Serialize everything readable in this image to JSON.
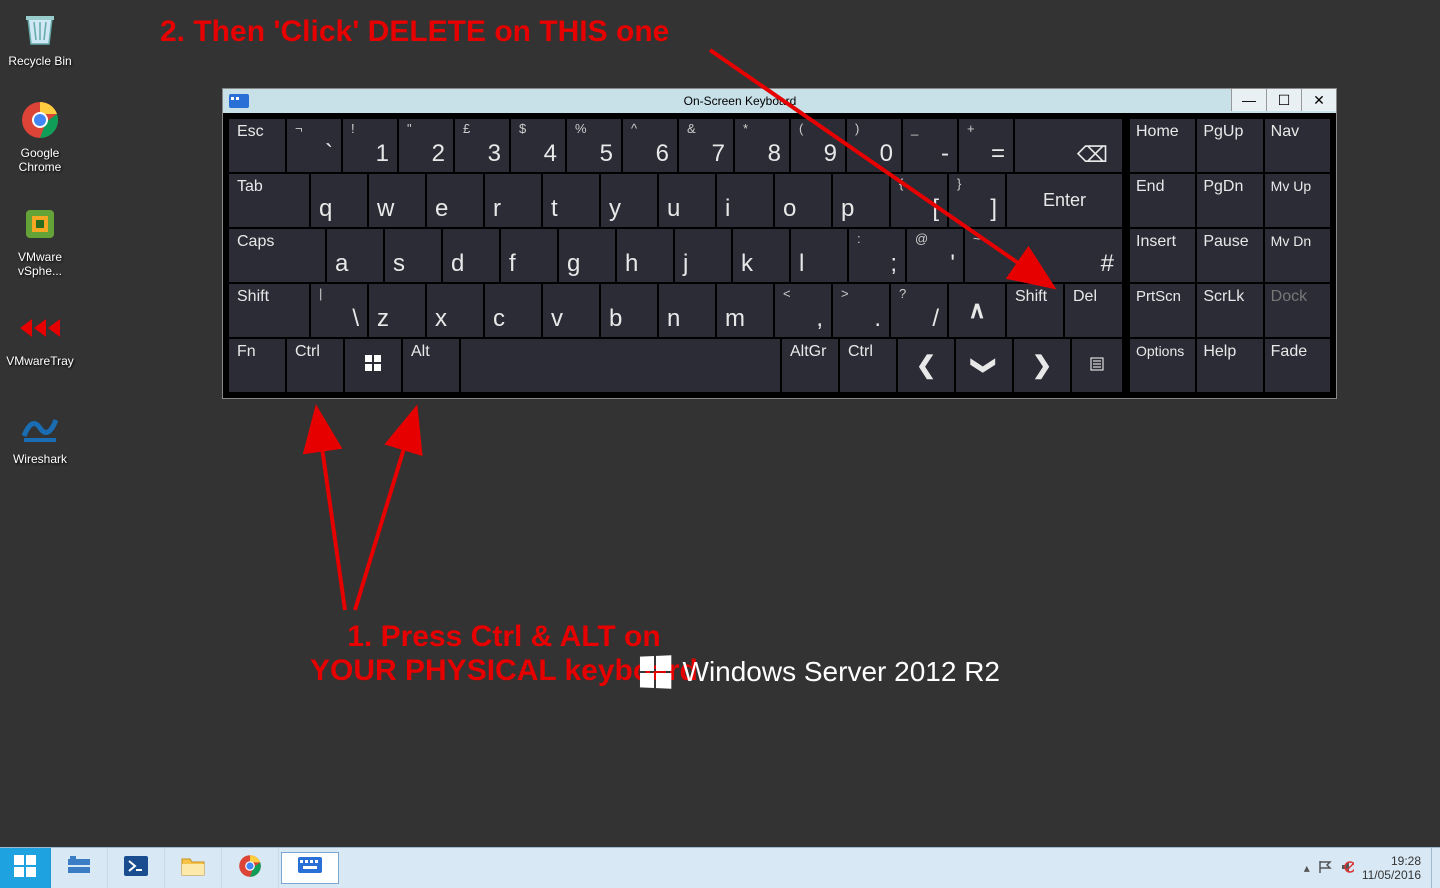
{
  "desktop_icons": [
    {
      "label": "Recycle Bin"
    },
    {
      "label": "Google Chrome"
    },
    {
      "label": "VMware vSphe..."
    },
    {
      "label": "VMwareTray"
    },
    {
      "label": "Wireshark"
    }
  ],
  "osk": {
    "title": "On-Screen Keyboard",
    "row1": {
      "esc": "Esc",
      "nums": [
        {
          "top": "¬",
          "main": "`"
        },
        {
          "top": "!",
          "main": "1"
        },
        {
          "top": "\"",
          "main": "2"
        },
        {
          "top": "£",
          "main": "3"
        },
        {
          "top": "$",
          "main": "4"
        },
        {
          "top": "%",
          "main": "5"
        },
        {
          "top": "^",
          "main": "6"
        },
        {
          "top": "&",
          "main": "7"
        },
        {
          "top": "*",
          "main": "8"
        },
        {
          "top": "(",
          "main": "9"
        },
        {
          "top": ")",
          "main": "0"
        },
        {
          "top": "_",
          "main": "-"
        },
        {
          "top": "+",
          "main": "="
        }
      ],
      "bksp": "⌫"
    },
    "row2": {
      "tab": "Tab",
      "letters": [
        "q",
        "w",
        "e",
        "r",
        "t",
        "y",
        "u",
        "i",
        "o",
        "p"
      ],
      "br1": {
        "top": "{",
        "main": "["
      },
      "br2": {
        "top": "}",
        "main": "]"
      },
      "enter": "Enter"
    },
    "row3": {
      "caps": "Caps",
      "letters": [
        "a",
        "s",
        "d",
        "f",
        "g",
        "h",
        "j",
        "k",
        "l"
      ],
      "semi": {
        "top": ":",
        "main": ";"
      },
      "quote": {
        "top": "@",
        "main": "'"
      },
      "hash": {
        "top": "~",
        "main": "#"
      }
    },
    "row4": {
      "lshift": "Shift",
      "bslash": {
        "top": "|",
        "main": "\\"
      },
      "letters": [
        "z",
        "x",
        "c",
        "v",
        "b",
        "n",
        "m"
      ],
      "comma": {
        "top": "<",
        "main": ","
      },
      "dot": {
        "top": ">",
        "main": "."
      },
      "slash": {
        "top": "?",
        "main": "/"
      },
      "up": "∧",
      "rshift": "Shift",
      "del": "Del"
    },
    "row5": {
      "fn": "Fn",
      "ctrl": "Ctrl",
      "alt": "Alt",
      "altgr": "AltGr",
      "rctrl": "Ctrl",
      "left": "❮",
      "down": "❯",
      "right": "❯"
    },
    "side": [
      [
        "Home",
        "PgUp",
        "Nav"
      ],
      [
        "End",
        "PgDn",
        "Mv Up"
      ],
      [
        "Insert",
        "Pause",
        "Mv Dn"
      ],
      [
        "PrtScn",
        "ScrLk",
        "Dock"
      ],
      [
        "Options",
        "Help",
        "Fade"
      ]
    ]
  },
  "annotations": {
    "top": "2. Then 'Click' DELETE on THIS one",
    "bottom": "1. Press Ctrl & ALT on\nYOUR PHYSICAL keyboard"
  },
  "branding": "Windows Server 2012 R2",
  "tray": {
    "time": "19:28",
    "date": "11/05/2016"
  }
}
